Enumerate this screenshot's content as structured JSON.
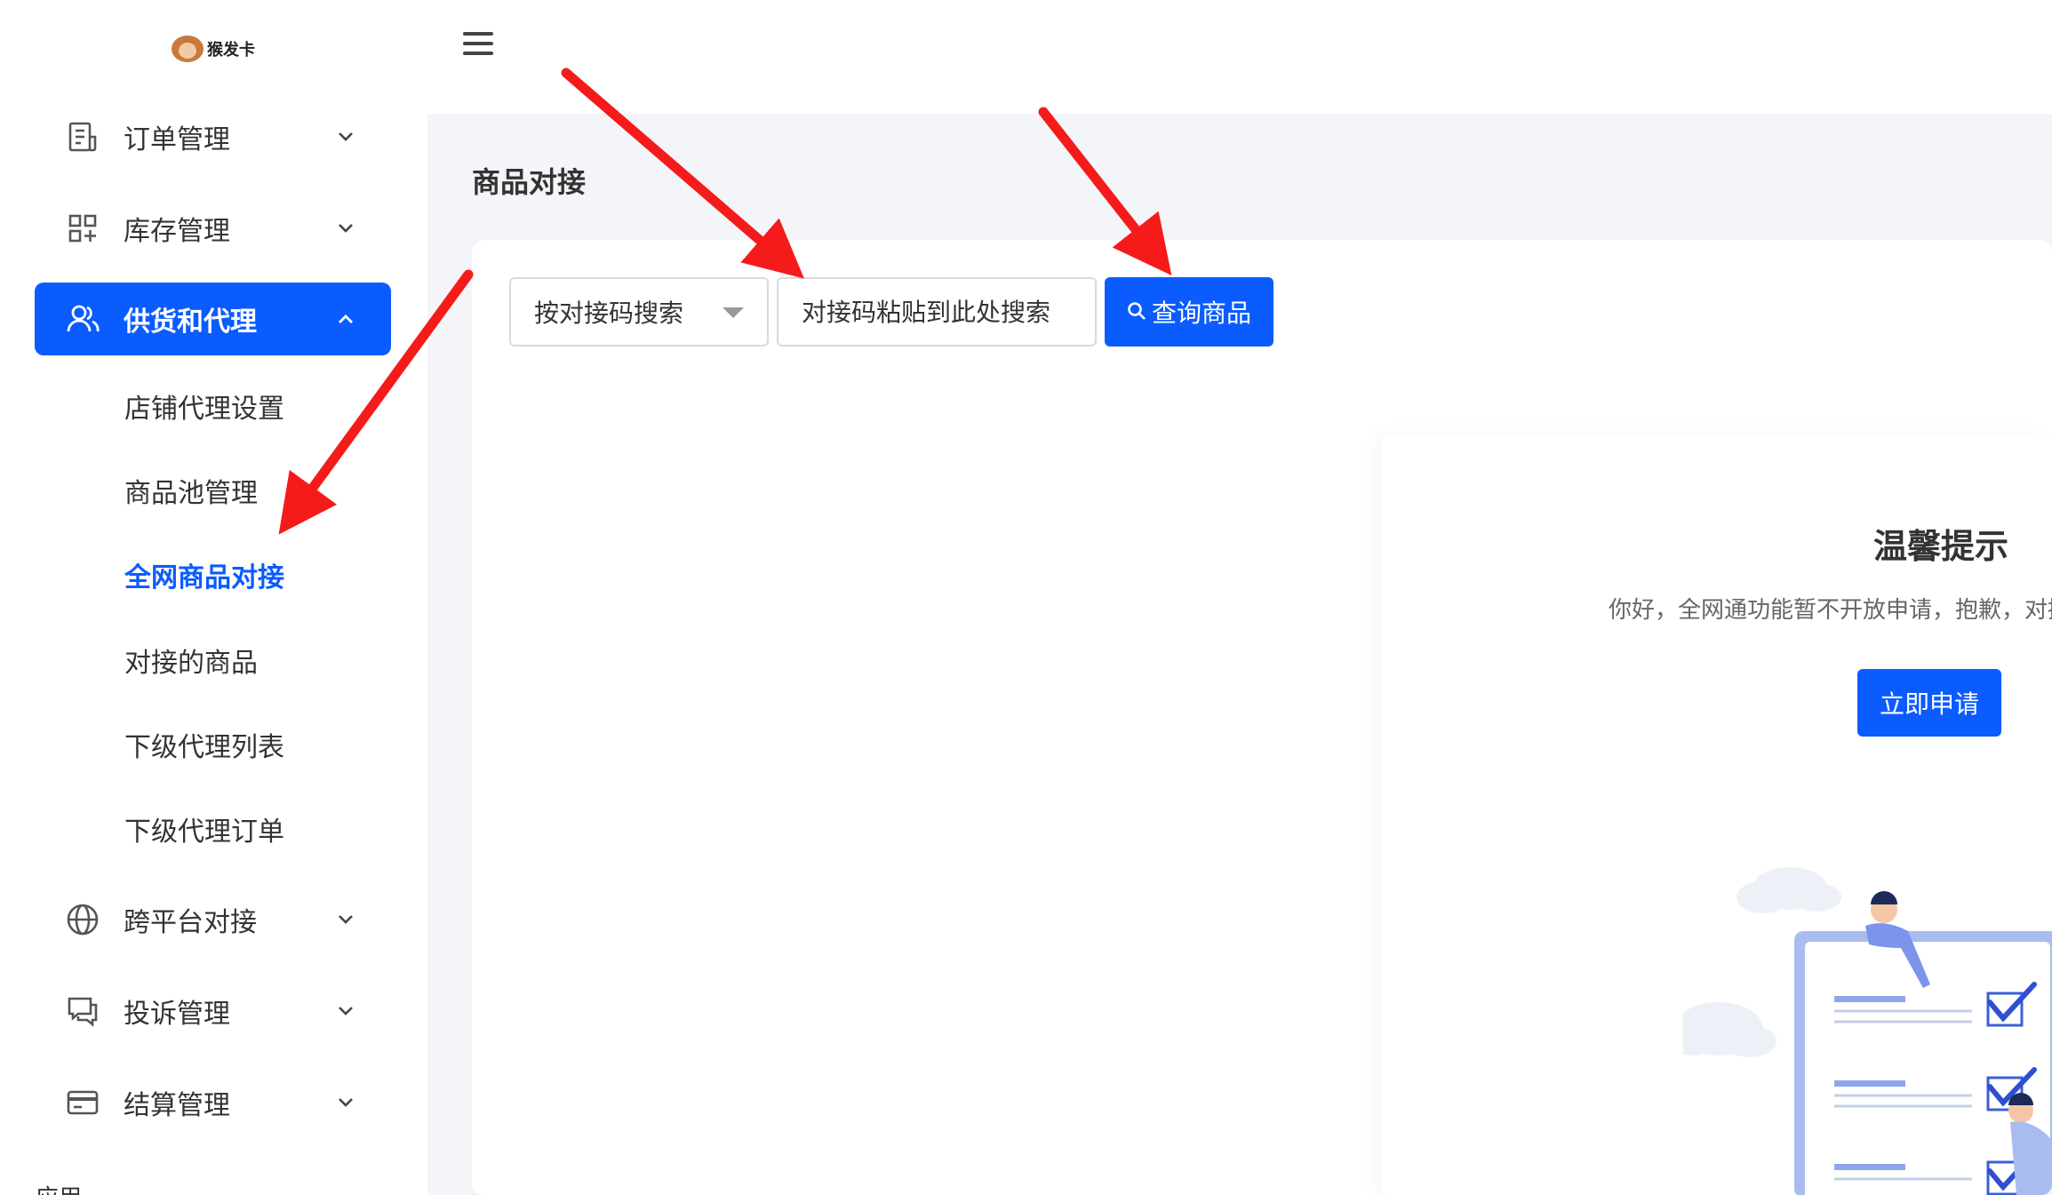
{
  "logo": {
    "text": "猴发卡"
  },
  "sidebar": {
    "items": [
      {
        "label": "订单管理",
        "icon": "order-icon"
      },
      {
        "label": "库存管理",
        "icon": "inventory-icon"
      },
      {
        "label": "供货和代理",
        "icon": "users-icon",
        "expanded": true
      },
      {
        "label": "跨平台对接",
        "icon": "globe-icon"
      },
      {
        "label": "投诉管理",
        "icon": "complaint-icon"
      },
      {
        "label": "结算管理",
        "icon": "settlement-icon"
      }
    ],
    "subitems": [
      {
        "label": "店铺代理设置"
      },
      {
        "label": "商品池管理"
      },
      {
        "label": "全网商品对接",
        "current": true
      },
      {
        "label": "对接的商品"
      },
      {
        "label": "下级代理列表"
      },
      {
        "label": "下级代理订单"
      }
    ],
    "bottom_label": "应用"
  },
  "main": {
    "page_title": "商品对接",
    "search": {
      "select_value": "按对接码搜索",
      "placeholder": "对接码粘贴到此处搜索",
      "button_label": "查询商品"
    },
    "notice": {
      "title": "温馨提示",
      "text": "你好，全网通功能暂不开放申请，抱歉，对接",
      "button_label": "立即申请"
    }
  },
  "colors": {
    "accent": "#0b5cff",
    "annotation_arrow": "#f51b1b",
    "page_bg": "#f4f5f9"
  }
}
